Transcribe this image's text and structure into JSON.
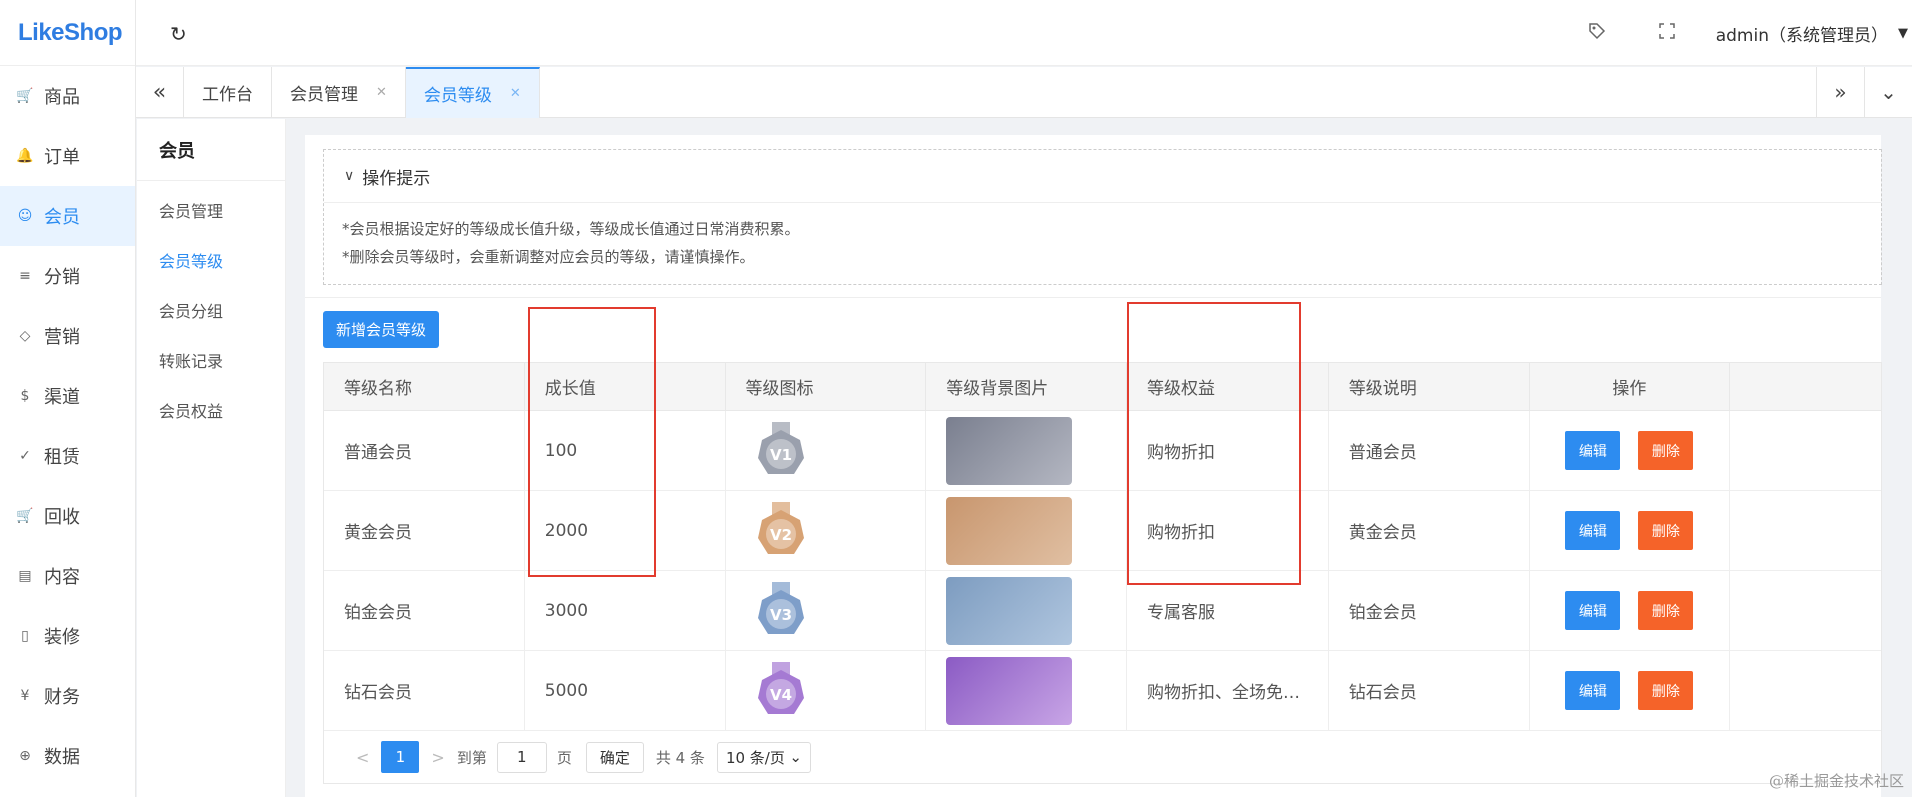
{
  "logo": "LikeShop",
  "nav": [
    {
      "label": "商品",
      "icon": "cart-icon"
    },
    {
      "label": "订单",
      "icon": "bell-icon"
    },
    {
      "label": "会员",
      "icon": "user-icon",
      "active": true
    },
    {
      "label": "分销",
      "icon": "layers-icon"
    },
    {
      "label": "营销",
      "icon": "diamond-icon"
    },
    {
      "label": "渠道",
      "icon": "dollar-icon"
    },
    {
      "label": "租赁",
      "icon": "shield-icon"
    },
    {
      "label": "回收",
      "icon": "cart-icon"
    },
    {
      "label": "内容",
      "icon": "book-icon"
    },
    {
      "label": "装修",
      "icon": "tablet-icon"
    },
    {
      "label": "财务",
      "icon": "yen-icon"
    },
    {
      "label": "数据",
      "icon": "globe-icon"
    }
  ],
  "header": {
    "user": "admin（系统管理员）"
  },
  "tabs": [
    {
      "label": "工作台",
      "closable": false,
      "active": false
    },
    {
      "label": "会员管理",
      "closable": true,
      "active": false
    },
    {
      "label": "会员等级",
      "closable": true,
      "active": true
    }
  ],
  "subnav": {
    "title": "会员",
    "items": [
      {
        "label": "会员管理",
        "active": false
      },
      {
        "label": "会员等级",
        "active": true
      },
      {
        "label": "会员分组",
        "active": false
      },
      {
        "label": "转账记录",
        "active": false
      },
      {
        "label": "会员权益",
        "active": false
      }
    ]
  },
  "tips": {
    "title": "操作提示",
    "lines": [
      "*会员根据设定好的等级成长值升级，等级成长值通过日常消费积累。",
      "*删除会员等级时，会重新调整对应会员的等级，请谨慎操作。"
    ]
  },
  "add_button": "新增会员等级",
  "table": {
    "columns": [
      "等级名称",
      "成长值",
      "等级图标",
      "等级背景图片",
      "等级权益",
      "等级说明",
      "操作",
      ""
    ],
    "rows": [
      {
        "name": "普通会员",
        "growth": "100",
        "badge": "V1",
        "badge_color": "#9aa0ad",
        "rights": "购物折扣",
        "desc": "普通会员"
      },
      {
        "name": "黄金会员",
        "growth": "2000",
        "badge": "V2",
        "badge_color": "#d7a274",
        "rights": "购物折扣",
        "desc": "黄金会员"
      },
      {
        "name": "铂金会员",
        "growth": "3000",
        "badge": "V3",
        "badge_color": "#7e9ec9",
        "rights": "专属客服",
        "desc": "铂金会员"
      },
      {
        "name": "钻石会员",
        "growth": "5000",
        "badge": "V4",
        "badge_color": "#a57ad3",
        "rights": "购物折扣、全场免…",
        "desc": "钻石会员"
      }
    ],
    "edit_label": "编辑",
    "delete_label": "删除"
  },
  "pager": {
    "current": "1",
    "goto_label": "到第",
    "goto_value": "1",
    "page_label": "页",
    "confirm": "确定",
    "total": "共 4 条",
    "size": "10 条/页"
  },
  "watermark": "@稀土掘金技术社区"
}
